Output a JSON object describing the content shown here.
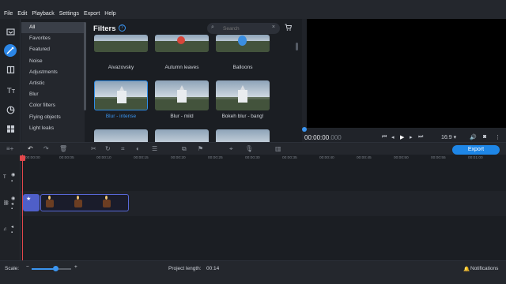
{
  "menu": [
    "File",
    "Edit",
    "Playback",
    "Settings",
    "Export",
    "Help"
  ],
  "rail_icons": [
    "import-icon",
    "filters-icon",
    "transitions-icon",
    "titles-icon",
    "stickers-icon",
    "more-tools-icon"
  ],
  "categories": [
    "All",
    "Favorites",
    "Featured",
    "Noise",
    "Adjustments",
    "Artistic",
    "Blur",
    "Color filters",
    "Flying objects",
    "Light leaks"
  ],
  "filters": {
    "title": "Filters",
    "help": "?",
    "search_placeholder": "Search",
    "clear": "×",
    "cart": "🛒",
    "row1": [
      "Aivazovsky",
      "Autumn leaves",
      "Balloons"
    ],
    "row2": [
      "Blur - intense",
      "Blur - mild",
      "Bokeh blur - bang!"
    ]
  },
  "preview": {
    "timecode": "00:00:00",
    "timecode_ms": ".000",
    "aspect": "16:9 ▾"
  },
  "toolbar": {
    "export_label": "Export"
  },
  "ruler_ticks": [
    "00:00:00",
    "00:00:05",
    "00:00:10",
    "00:00:15",
    "00:00:20",
    "00:00:25",
    "00:00:30",
    "00:00:35",
    "00:00:40",
    "00:00:45",
    "00:00:50",
    "00:00:55",
    "00:01:00"
  ],
  "status": {
    "scale_label": "Scale:",
    "scale_value": 0.6,
    "project_length_label": "Project length:",
    "project_length": "00:14",
    "notifications": "Notifications"
  },
  "colors": {
    "accent": "#1e86e6",
    "playhead": "#e2474b",
    "title_clip": "#4f5fc8"
  }
}
